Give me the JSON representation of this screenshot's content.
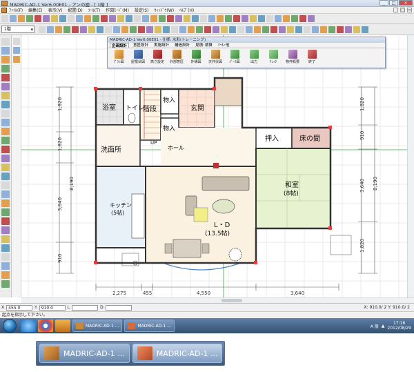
{
  "window": {
    "title": "MADRIC-AD-1 Ver6.00E01 - アンの図 - [ 1階 ]",
    "buttons": [
      "_",
      "□",
      "×"
    ]
  },
  "menu": {
    "items": [
      "ﾌｧｲﾙ(F)",
      "編集(E)",
      "表示(V)",
      "配置(D)",
      "ﾂｰﾙ(T)",
      "作図ﾓｰﾄﾞ(M)",
      "設定(S)",
      "ｳｨﾝﾄﾞｳ(W)",
      "ﾍﾙﾌﾟ(H)"
    ]
  },
  "toolbar": {
    "floor_select": "1階"
  },
  "palette": {
    "title": "MADRIC-AD-1 Ver6.00E01 - 仕様: 水彩(トレーニング)",
    "tabs": [
      "企画設計",
      "意匠設計",
      "実施設計",
      "構造設計",
      "見積･積算",
      "ﾂｰﾙ･他"
    ],
    "active_tab": "企画設計",
    "icons": [
      {
        "label": "ﾌﾟﾗﾝ図",
        "icon": "plan-icon"
      },
      {
        "label": "屋根伏図",
        "icon": "roof-icon"
      },
      {
        "label": "高さ設定",
        "icon": "height-icon"
      },
      {
        "label": "外部意匠",
        "icon": "exterior-icon"
      },
      {
        "label": "外構図",
        "icon": "landscape-icon"
      },
      {
        "label": "天井伏図",
        "icon": "ceiling-icon"
      },
      {
        "label": "ﾊﾟｰｽ図",
        "icon": "perspective-icon"
      },
      {
        "label": "出力",
        "icon": "output-icon"
      },
      {
        "label": "ﾁｪｯｸ",
        "icon": "check-icon"
      },
      {
        "label": "物件概要",
        "icon": "property-icon"
      },
      {
        "label": "終了",
        "icon": "exit-icon"
      }
    ]
  },
  "plan": {
    "rooms": {
      "bath": "浴室",
      "toilet": "トイレ",
      "stairs": "階段",
      "storage1": "物入",
      "entrance": "玄関",
      "storage2": "物入",
      "hall": "ホール",
      "washroom": "洗面所",
      "closet": "押入",
      "tokonoma": "床の間",
      "japanese_room": "和室",
      "japanese_room_size": "(8帖)",
      "kitchen": "キッチン",
      "kitchen_size": "(5帖)",
      "ld": "L・D",
      "ld_size": "(13.5帖)",
      "up_label": "UP"
    },
    "dims_bottom": [
      "2,275",
      "455",
      "4,550",
      "3,640"
    ],
    "dims_left": [
      "1,820",
      "1,820",
      "8,190",
      "3,640",
      "910"
    ],
    "dims_right": [
      "1,820",
      "910",
      "3,640",
      "8,190",
      "1,820"
    ]
  },
  "coordbar": {
    "x_label": "X",
    "x_value": "455.0",
    "y_label": "Y",
    "y_value": "910.0",
    "l_label": "L",
    "d_label": "D",
    "right_text": "X: 910.0/ 2    Y: 910.0/ 2"
  },
  "status": {
    "message": "起点を指示して下さい。"
  },
  "taskbar": {
    "tasks": [
      "MADRIC-AD-1 ...",
      "MADRIC-AD-1 ..."
    ],
    "ime": "A 般",
    "clock_time": "17:16",
    "clock_date": "2012/08/29"
  },
  "big_tasks": [
    "MADRIC-AD-1 ...",
    "MADRIC-AD-1 ..."
  ]
}
